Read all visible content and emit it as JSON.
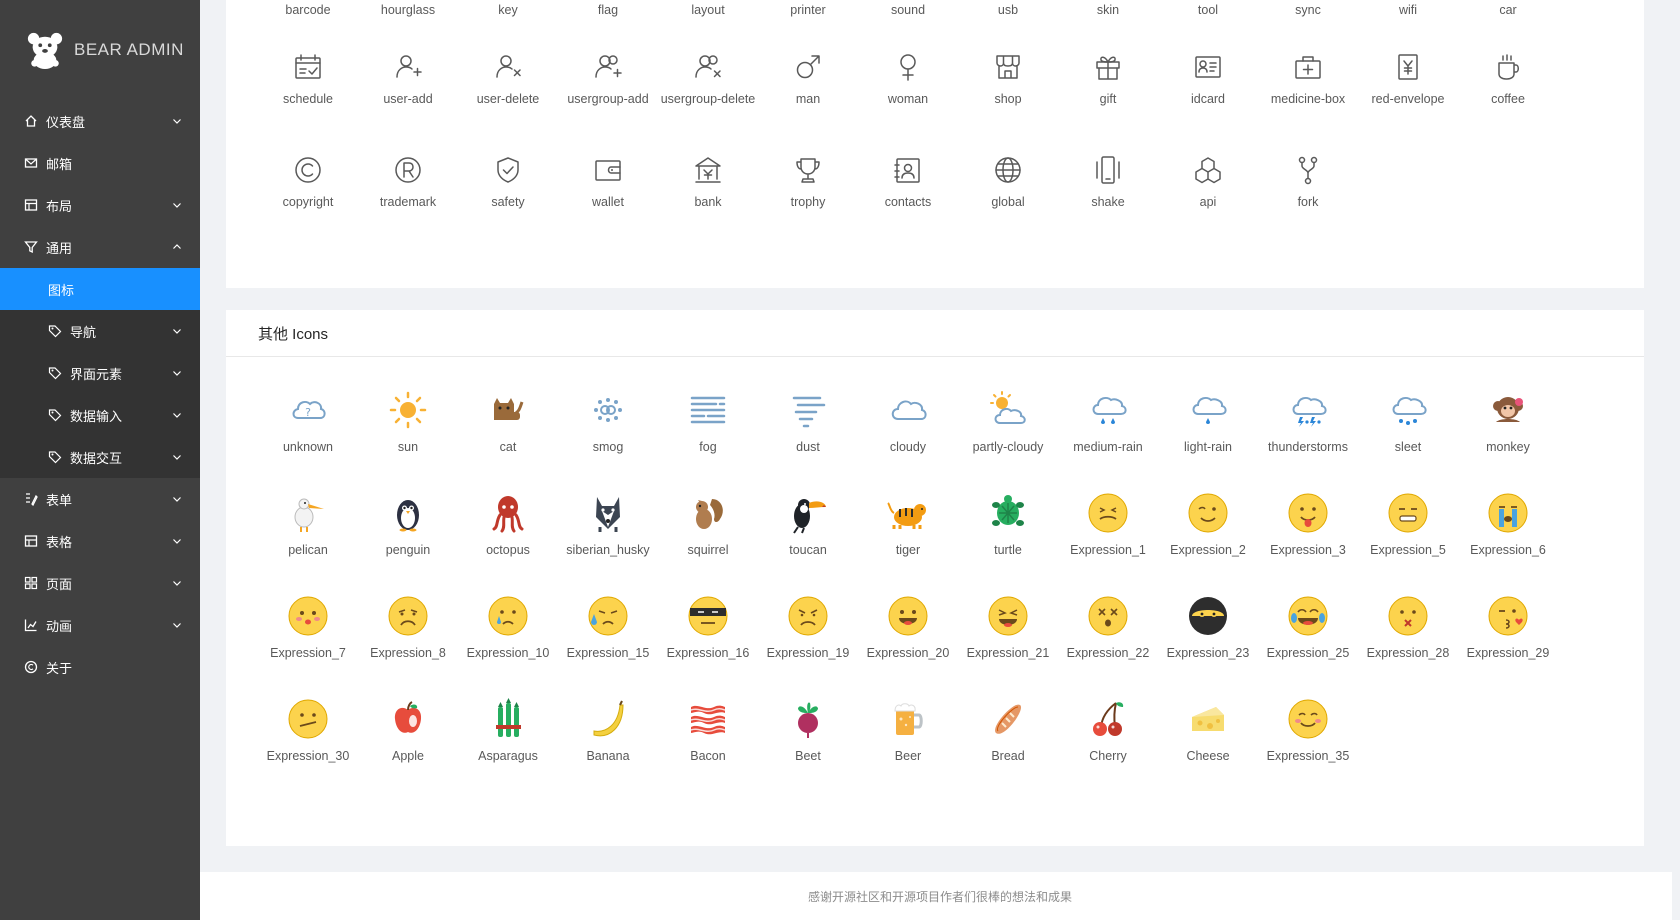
{
  "app": {
    "title": "BEAR ADMIN",
    "logo_icon": "bear-icon"
  },
  "sidebar": {
    "items": [
      {
        "label": "仪表盘",
        "icon": "home-icon",
        "expandable": true,
        "chevron": "down"
      },
      {
        "label": "邮箱",
        "icon": "mail-icon",
        "expandable": false
      },
      {
        "label": "布局",
        "icon": "layout-icon",
        "expandable": true,
        "chevron": "down"
      },
      {
        "label": "通用",
        "icon": "filter-icon",
        "expandable": true,
        "chevron": "up",
        "open": true
      },
      {
        "label": "图标",
        "sub": true,
        "active": true
      },
      {
        "label": "导航",
        "icon": "tag-icon",
        "sub": true,
        "chevron": "down"
      },
      {
        "label": "界面元素",
        "icon": "tag-icon",
        "sub": true,
        "chevron": "down"
      },
      {
        "label": "数据输入",
        "icon": "tag-icon",
        "sub": true,
        "chevron": "down"
      },
      {
        "label": "数据交互",
        "icon": "tag-icon",
        "sub": true,
        "chevron": "down"
      },
      {
        "label": "表单",
        "icon": "form-icon",
        "expandable": true,
        "chevron": "down"
      },
      {
        "label": "表格",
        "icon": "table-icon",
        "expandable": true,
        "chevron": "down"
      },
      {
        "label": "页面",
        "icon": "appstore-icon",
        "expandable": true,
        "chevron": "down"
      },
      {
        "label": "动画",
        "icon": "chart-icon",
        "expandable": true,
        "chevron": "down"
      },
      {
        "label": "关于",
        "icon": "copyright-icon",
        "expandable": false
      }
    ],
    "active_color": "#1890ff"
  },
  "icons_card": {
    "top_row": [
      "barcode",
      "hourglass",
      "key",
      "flag",
      "layout",
      "printer",
      "sound",
      "usb",
      "skin",
      "tool",
      "sync",
      "wifi",
      "car"
    ],
    "rows": [
      [
        "schedule",
        "user-add",
        "user-delete",
        "usergroup-add",
        "usergroup-delete",
        "man",
        "woman",
        "shop",
        "gift",
        "idcard",
        "medicine-box",
        "red-envelope",
        "coffee"
      ],
      [
        "copyright",
        "trademark",
        "safety",
        "wallet",
        "bank",
        "trophy",
        "contacts",
        "global",
        "shake",
        "api",
        "fork"
      ]
    ]
  },
  "other_card": {
    "title": "其他 Icons",
    "rows": [
      [
        "unknown",
        "sun",
        "cat",
        "smog",
        "fog",
        "dust",
        "cloudy",
        "partly-cloudy",
        "medium-rain",
        "light-rain",
        "thunderstorms",
        "sleet",
        "monkey"
      ],
      [
        "pelican",
        "penguin",
        "octopus",
        "siberian_husky",
        "squirrel",
        "toucan",
        "tiger",
        "turtle",
        "Expression_1",
        "Expression_2",
        "Expression_3",
        "Expression_5",
        "Expression_6"
      ],
      [
        "Expression_7",
        "Expression_8",
        "Expression_10",
        "Expression_15",
        "Expression_16",
        "Expression_19",
        "Expression_20",
        "Expression_21",
        "Expression_22",
        "Expression_23",
        "Expression_25",
        "Expression_28",
        "Expression_29"
      ],
      [
        "Expression_30",
        "Apple",
        "Asparagus",
        "Banana",
        "Bacon",
        "Beet",
        "Beer",
        "Bread",
        "Cherry",
        "Cheese",
        "Expression_35"
      ]
    ]
  },
  "footer": {
    "text": "感谢开源社区和开源项目作者们很棒的想法和成果"
  }
}
